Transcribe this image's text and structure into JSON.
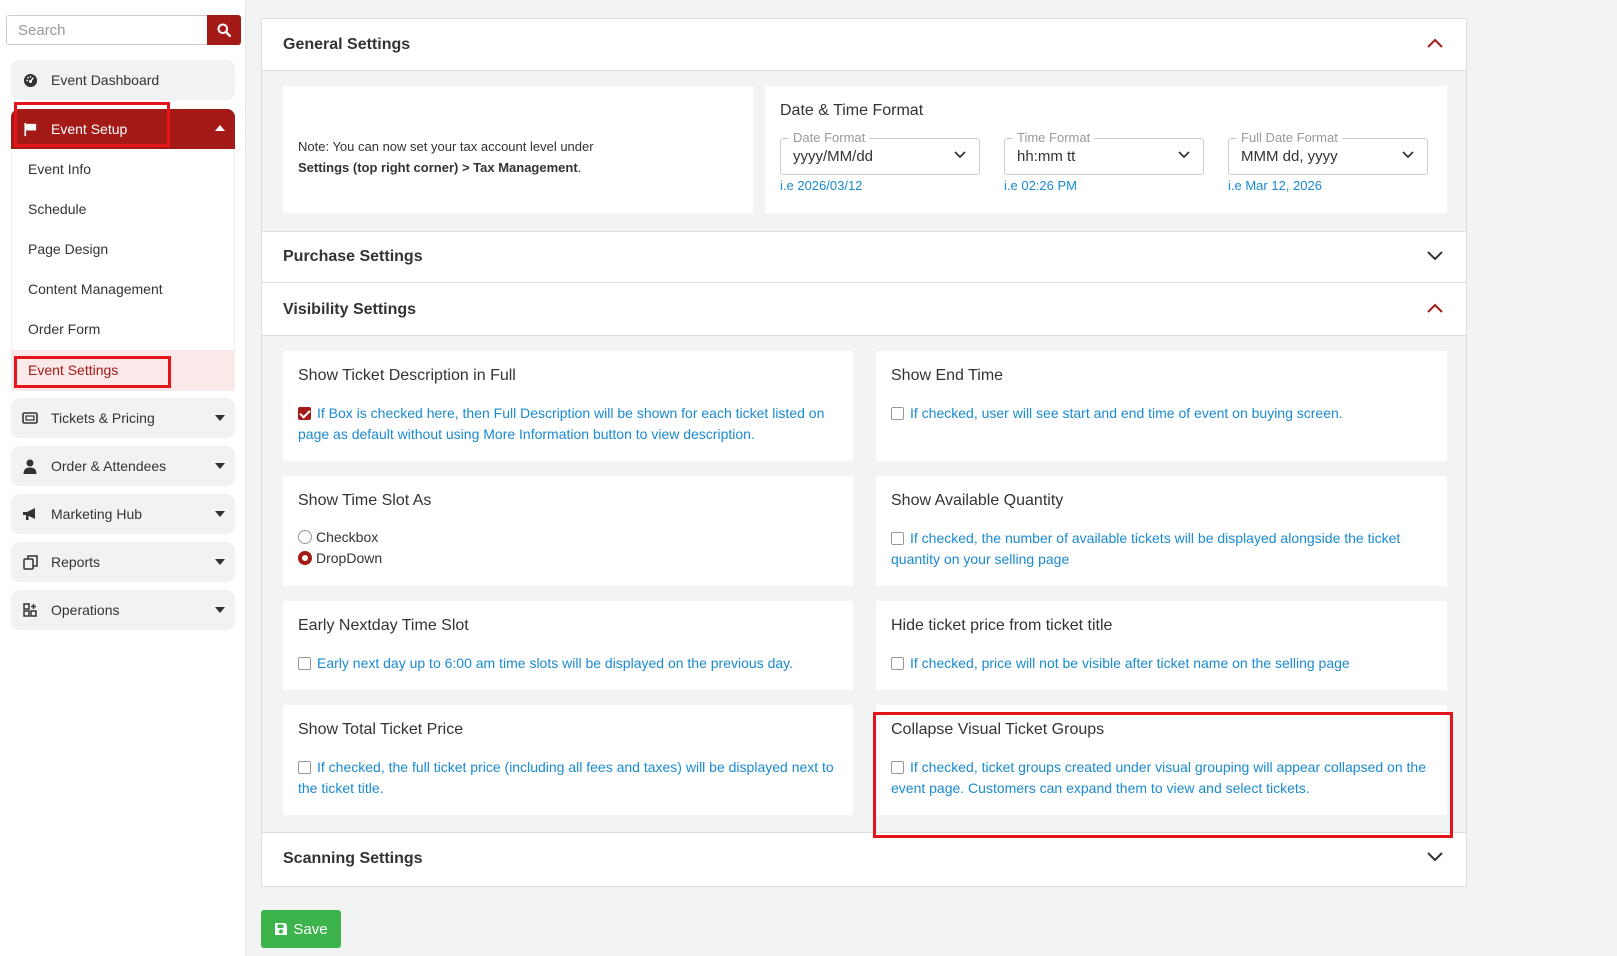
{
  "sidebar": {
    "search_placeholder": "Search",
    "nav": {
      "dashboard": "Event Dashboard",
      "event_setup": "Event Setup",
      "tickets": "Tickets & Pricing",
      "orders": "Order & Attendees",
      "marketing": "Marketing Hub",
      "reports": "Reports",
      "operations": "Operations"
    },
    "submenu": {
      "event_info": "Event Info",
      "schedule": "Schedule",
      "page_design": "Page Design",
      "content": "Content Management",
      "order_form": "Order Form",
      "event_settings": "Event Settings"
    }
  },
  "sections": {
    "general": "General Settings",
    "purchase": "Purchase Settings",
    "visibility": "Visibility Settings",
    "scanning": "Scanning Settings"
  },
  "general": {
    "note_line1": "Note: You can now set your tax account level under",
    "note_bold": "Settings (top right corner) > Tax Management",
    "note_end": ".",
    "datetime_title": "Date & Time Format",
    "date_format": {
      "label": "Date Format",
      "value": "yyyy/MM/dd",
      "hint": "i.e 2026/03/12"
    },
    "time_format": {
      "label": "Time Format",
      "value": "hh:mm tt",
      "hint": "i.e 02:26 PM"
    },
    "full_date_format": {
      "label": "Full Date Format",
      "value": "MMM dd, yyyy",
      "hint": "i.e Mar 12, 2026"
    }
  },
  "visibility": {
    "show_desc": {
      "title": "Show Ticket Description in Full",
      "desc": "If Box is checked here, then Full Description will be shown for each ticket listed on page as default without using More Information button to view description.",
      "checked": true
    },
    "show_end_time": {
      "title": "Show End Time",
      "desc": "If checked, user will see start and end time of event on buying screen.",
      "checked": false
    },
    "time_slot": {
      "title": "Show Time Slot As",
      "options": [
        "Checkbox",
        "DropDown"
      ],
      "selected": "DropDown"
    },
    "available_qty": {
      "title": "Show Available Quantity",
      "desc": "If checked, the number of available tickets will be displayed alongside the ticket quantity on your selling page",
      "checked": false
    },
    "early_nextday": {
      "title": "Early Nextday Time Slot",
      "desc": "Early next day up to 6:00 am time slots will be displayed on the previous day.",
      "checked": false
    },
    "hide_price": {
      "title": "Hide ticket price from ticket title",
      "desc": "If checked, price will not be visible after ticket name on the selling page",
      "checked": false
    },
    "total_price": {
      "title": "Show Total Ticket Price",
      "desc": "If checked, the full ticket price (including all fees and taxes) will be displayed next to the ticket title.",
      "checked": false
    },
    "collapse_groups": {
      "title": "Collapse Visual Ticket Groups",
      "desc": "If checked, ticket groups created under visual grouping will appear collapsed on the event page. Customers can expand them to view and select tickets.",
      "checked": false
    }
  },
  "save_label": "Save",
  "colors": {
    "brand": "#a31a17",
    "link": "#1a8ad1",
    "save": "#3cb44b",
    "highlight": "#e4141b"
  }
}
